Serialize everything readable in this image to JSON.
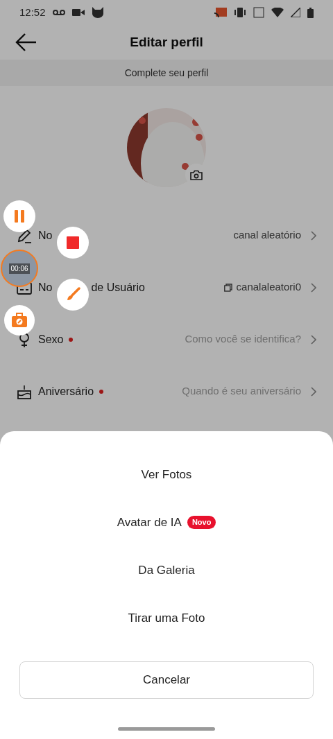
{
  "status_bar": {
    "time": "12:52"
  },
  "header": {
    "title": "Editar perfil"
  },
  "banner": "Complete seu perfil",
  "rows": [
    {
      "kind": "name",
      "label": "No",
      "value": "canal aleatório",
      "required": false,
      "placeholder_style": false
    },
    {
      "kind": "username",
      "label": "No",
      "label_tail": "de Usuário",
      "value": "canalaleatori0",
      "required": false,
      "placeholder_style": false
    },
    {
      "kind": "gender",
      "label": "Sexo",
      "value": "Como você se identifica?",
      "required": true,
      "placeholder_style": true
    },
    {
      "kind": "birthday",
      "label": "Aniversário",
      "value": "Quando é seu aniversário",
      "required": true,
      "placeholder_style": true
    }
  ],
  "recorder": {
    "timer": "00:06"
  },
  "sheet": {
    "options": [
      {
        "label": "Ver Fotos"
      },
      {
        "label": "Avatar de IA",
        "badge": "Novo"
      },
      {
        "label": "Da Galeria"
      },
      {
        "label": "Tirar uma Foto"
      }
    ],
    "cancel": "Cancelar"
  }
}
